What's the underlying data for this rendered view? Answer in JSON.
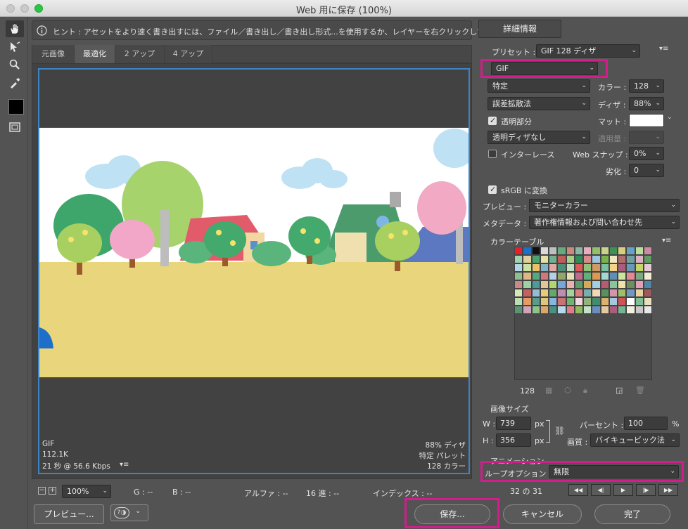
{
  "window": {
    "title": "Web 用に保存 (100%)"
  },
  "hint": {
    "text": "ヒント : アセットをより速く書き出すには、ファイル／書き出し／書き出し形式...を使用するか、レイヤーを右クリックして使用。"
  },
  "tabs": [
    "元画像",
    "最適化",
    "2 アップ",
    "4 アップ"
  ],
  "active_tab": "最適化",
  "stats": {
    "left": [
      "GIF",
      "112.1K",
      "21 秒 @ 56.6 Kbps"
    ],
    "right": [
      "88% ディザ",
      "特定 パレット",
      "128 カラー"
    ]
  },
  "statusbar": {
    "zoom": "100%",
    "g": "G : --",
    "b": "B : --",
    "alpha": "アルファ : --",
    "hex": "16 進 : --",
    "index": "インデックス : --"
  },
  "right_panel": {
    "details_button": "詳細情報",
    "preset_label": "プリセット :",
    "preset_value": "GIF 128 ディザ",
    "format": "GIF",
    "palette": "特定",
    "colors_label": "カラー :",
    "colors_value": "128",
    "dither_method": "誤差拡散法",
    "dither_label": "ディザ :",
    "dither_value": "88%",
    "transparency_label": "透明部分",
    "matte_label": "マット :",
    "transparency_dither": "透明ディザなし",
    "amount_label": "適用量 :",
    "interlace_label": "インターレース",
    "websnap_label": "Web スナップ :",
    "websnap_value": "0%",
    "lossy_label": "劣化 :",
    "lossy_value": "0",
    "srgb_label": "sRGB に変換",
    "preview_label": "プレビュー :",
    "preview_value": "モニターカラー",
    "metadata_label": "メタデータ :",
    "metadata_value": "著作権情報および問い合わせ先",
    "color_table_label": "カラーテーブル",
    "color_count": "128",
    "image_size_label": "画像サイズ",
    "w_label": "W :",
    "w_value": "739",
    "h_label": "H :",
    "h_value": "356",
    "px": "px",
    "percent_label": "パーセント :",
    "percent_value": "100",
    "percent_unit": "%",
    "quality_label": "画質 :",
    "quality_value": "バイキュービック法",
    "animation_label": "アニメーション",
    "loop_label": "ループオプション :",
    "loop_value": "無限",
    "frame_counter": "32 の 31"
  },
  "buttons": {
    "preview": "プレビュー...",
    "save": "保存...",
    "cancel": "キャンセル",
    "done": "完了"
  },
  "colors": {
    "accent_highlight": "#d21d8a",
    "selection_blue": "#3d84c7",
    "panel_bg": "#535353"
  },
  "color_table": [
    "#e51f2b",
    "#1e6fc9",
    "#101010",
    "#d9d9d9",
    "#bfbfbf",
    "#6aa87e",
    "#c98a7b",
    "#89b6a5",
    "#e7aebf",
    "#8fc16b",
    "#c9d48a",
    "#3e9157",
    "#d8cf7d",
    "#68a1c8",
    "#b9df9b",
    "#cc8aa4",
    "#9fd4b0",
    "#e2cfa0",
    "#4aa36c",
    "#e4e0a6",
    "#6fb18d",
    "#c05c5c",
    "#a6cf88",
    "#2f8e58",
    "#d98a8a",
    "#9cc5df",
    "#78b34c",
    "#f2e7c3",
    "#b06d6d",
    "#71a0a0",
    "#ddb0c6",
    "#5f9c5f",
    "#b3d7e6",
    "#c8e3a2",
    "#e8c26b",
    "#82b3c6",
    "#e3a7a7",
    "#4f8f78",
    "#bfe0c5",
    "#dd5a5a",
    "#91c279",
    "#ce9b62",
    "#7cc0a0",
    "#f0d58b",
    "#a95d7d",
    "#6c98b8",
    "#c4d56a",
    "#e9c8d6",
    "#8fbf8f",
    "#e0b783",
    "#55a882",
    "#d17878",
    "#b5cfe8",
    "#93a56a",
    "#e8dfb1",
    "#c06b8d",
    "#64b07b",
    "#dd9a4f",
    "#a6d6d0",
    "#5d8fb7",
    "#cfe39c",
    "#e78796",
    "#7ea882",
    "#f3ecd7",
    "#c88989",
    "#9ecfa5",
    "#4d9a9a",
    "#e2c596",
    "#b1d66f",
    "#79a6d6",
    "#eab1b1",
    "#5e9e6b",
    "#d4a95c",
    "#a4cfe3",
    "#b85a70",
    "#89c59c",
    "#f0e2a8",
    "#6d8f5e",
    "#e0a0b8",
    "#4f87a8",
    "#d7e6b5",
    "#c66161",
    "#91bdd6",
    "#e6cc78",
    "#65a86b",
    "#bd8db4",
    "#a3d39a",
    "#dc7e7e",
    "#78aeb0",
    "#f1d7b6",
    "#58935f",
    "#cf97a9",
    "#9dbf6a",
    "#7099c2",
    "#ead2a0",
    "#9e5a5a",
    "#bcdcb4",
    "#e39d62",
    "#5a9c88",
    "#dcc77c",
    "#87b5de",
    "#ca7373",
    "#6fb56f",
    "#efd8e2",
    "#94b27c",
    "#3f8d6a",
    "#d8b26e",
    "#a6c7e0",
    "#d25353",
    "#ffffff",
    "#7fbf93",
    "#e8e0bc",
    "#5b9474",
    "#cfa3b8",
    "#8cc48c",
    "#dda86a",
    "#4c9180",
    "#b7d9ec",
    "#e17c8b",
    "#92ba5e",
    "#c3e1c9",
    "#6a8fbf",
    "#e4c9a4",
    "#a95e79",
    "#72b694",
    "#f4f0e0",
    "#c9c9c9",
    "#e8e8e8"
  ]
}
